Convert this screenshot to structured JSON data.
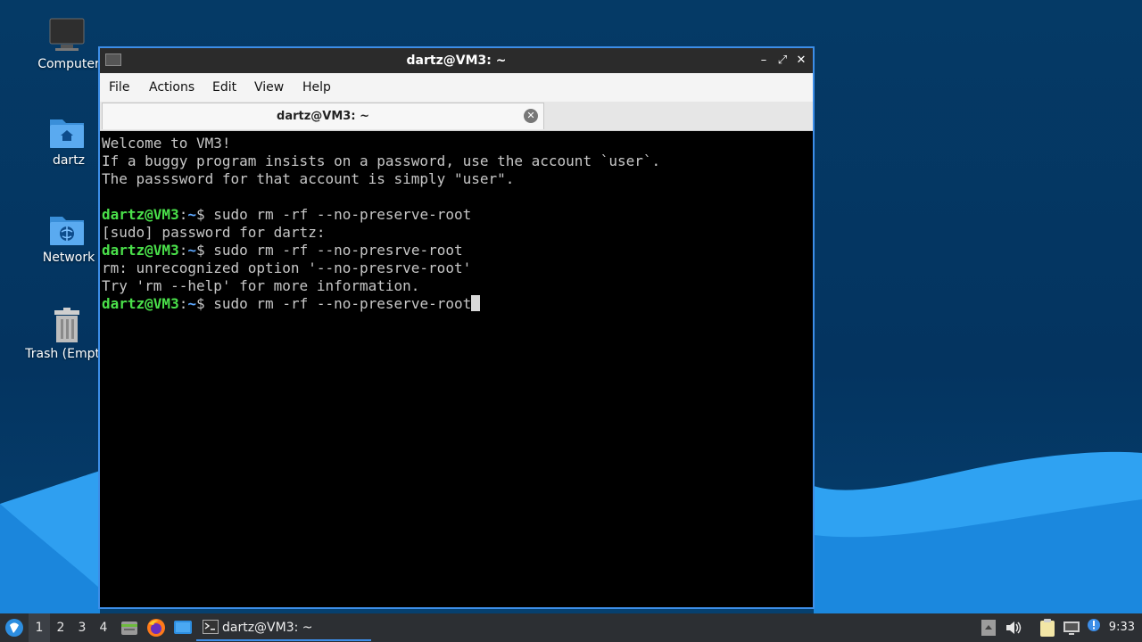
{
  "desktop": {
    "icons": [
      {
        "label": "Computer",
        "icon": "computer-icon"
      },
      {
        "label": "dartz",
        "icon": "home-folder-icon"
      },
      {
        "label": "Network",
        "icon": "network-folder-icon"
      },
      {
        "label": "Trash (Empty)",
        "icon": "trash-icon"
      }
    ]
  },
  "window": {
    "title": "dartz@VM3: ~",
    "controls": {
      "minimize": "–",
      "maximize": "⤢",
      "close": "✕"
    },
    "menu": [
      "File",
      "Actions",
      "Edit",
      "View",
      "Help"
    ],
    "tab": {
      "label": "dartz@VM3: ~",
      "close": "✕"
    }
  },
  "terminal": {
    "lines": [
      {
        "text": "Welcome to VM3!"
      },
      {
        "text": "If a buggy program insists on a password, use the account `user`."
      },
      {
        "text": "The passsword for that account is simply \"user\"."
      },
      {
        "text": ""
      },
      {
        "prompt": {
          "user": "dartz@VM3",
          "sep": ":",
          "path": "~",
          "sym": "$"
        },
        "command": " sudo rm -rf --no-preserve-root"
      },
      {
        "text": "[sudo] password for dartz:"
      },
      {
        "prompt": {
          "user": "dartz@VM3",
          "sep": ":",
          "path": "~",
          "sym": "$"
        },
        "command": " sudo rm -rf --no-presrve-root"
      },
      {
        "text": "rm: unrecognized option '--no-presrve-root'"
      },
      {
        "text": "Try 'rm --help' for more information."
      },
      {
        "prompt": {
          "user": "dartz@VM3",
          "sep": ":",
          "path": "~",
          "sym": "$"
        },
        "command": " sudo rm -rf --no-preserve-root",
        "cursor": true
      }
    ]
  },
  "taskbar": {
    "workspaces": [
      "1",
      "2",
      "3",
      "4"
    ],
    "active_workspace": "1",
    "task": {
      "label": "dartz@VM3: ~"
    },
    "clock": "9:33"
  },
  "colors": {
    "accent": "#3d8ee8",
    "prompt_user": "#4ae04a",
    "prompt_path": "#5da8ff"
  }
}
